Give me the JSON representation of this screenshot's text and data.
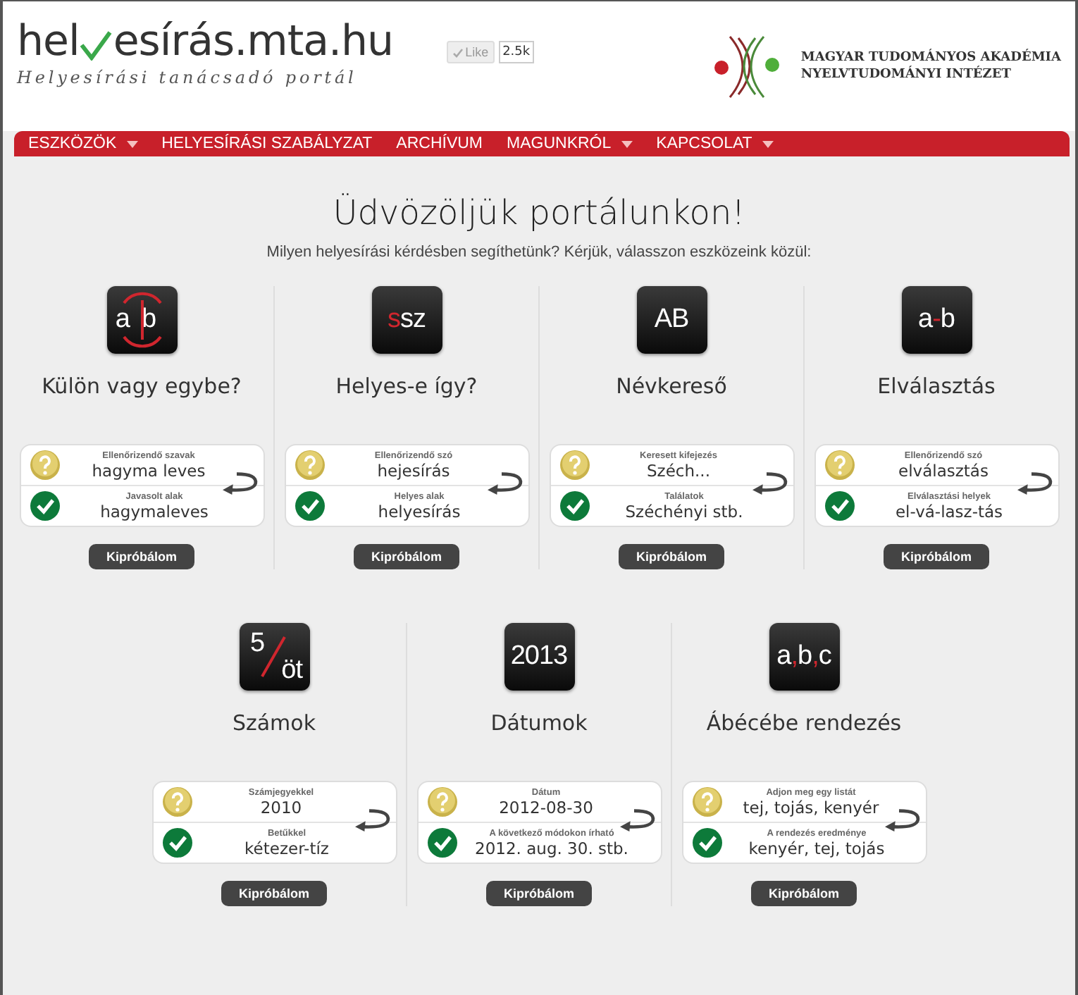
{
  "header": {
    "logo_start": "hel",
    "logo_end": "esírás.mta.hu",
    "tagline": "Helyesírási tanácsadó portál",
    "like": {
      "label": "Like",
      "count": "2.5k"
    },
    "institute": [
      "MAGYAR TUDOMÁNYOS AKADÉMIA",
      "NYELVTUDOMÁNYI INTÉZET"
    ]
  },
  "nav": [
    {
      "label": "ESZKÖZÖK",
      "dropdown": true
    },
    {
      "label": "HELYESÍRÁSI SZABÁLYZAT",
      "dropdown": false
    },
    {
      "label": "ARCHÍVUM",
      "dropdown": false
    },
    {
      "label": "MAGUNKRÓL",
      "dropdown": true
    },
    {
      "label": "KAPCSOLAT",
      "dropdown": true
    }
  ],
  "welcome": {
    "title": "Üdvözöljük portálunkon!",
    "subtitle": "Milyen helyesírási kérdésben segíthetünk? Kérjük, válasszon eszközeink közül:"
  },
  "tool_rows": [
    [
      {
        "kind": "split",
        "icon_parts": [
          {
            "text": "a",
            "accent": false
          },
          {
            "text": "b",
            "accent": false
          }
        ],
        "title": "Külön vagy egybe?",
        "question_label": "Ellenőrizendő szavak",
        "question": "hagyma leves",
        "answer_label": "Javasolt alak",
        "answer": "hagymaleves",
        "button": "Kipróbálom"
      },
      {
        "kind": "plain",
        "icon_parts": [
          {
            "text": "s",
            "accent": true
          },
          {
            "text": "sz",
            "accent": false
          }
        ],
        "title": "Helyes-e így?",
        "question_label": "Ellenőrizendő szó",
        "question": "hejesírás",
        "answer_label": "Helyes alak",
        "answer": "helyesírás",
        "button": "Kipróbálom"
      },
      {
        "kind": "plain",
        "icon_parts": [
          {
            "text": "AB",
            "accent": false
          }
        ],
        "title": "Névkereső",
        "question_label": "Keresett kifejezés",
        "question": "Széch...",
        "answer_label": "Találatok",
        "answer": "Széchényi stb.",
        "button": "Kipróbálom"
      },
      {
        "kind": "plain",
        "icon_parts": [
          {
            "text": "a",
            "accent": false
          },
          {
            "text": "-",
            "accent": true
          },
          {
            "text": "b",
            "accent": false
          }
        ],
        "title": "Elválasztás",
        "question_label": "Ellenőrizendő szó",
        "question": "elválasztás",
        "answer_label": "Elválasztási helyek",
        "answer": "el-vá-lasz-tás",
        "button": "Kipróbálom"
      }
    ],
    [
      {
        "kind": "fraction",
        "icon_parts": [
          {
            "text": "5",
            "accent": false
          },
          {
            "text": "öt",
            "accent": false
          }
        ],
        "title": "Számok",
        "question_label": "Számjegyekkel",
        "question": "2010",
        "answer_label": "Betűkkel",
        "answer": "kétezer-tíz",
        "button": "Kipróbálom"
      },
      {
        "kind": "plain",
        "icon_parts": [
          {
            "text": "2013",
            "accent": false
          }
        ],
        "title": "Dátumok",
        "question_label": "Dátum",
        "question": "2012-08-30",
        "answer_label": "A következő módokon írható",
        "answer": "2012. aug. 30. stb.",
        "button": "Kipróbálom"
      },
      {
        "kind": "plain",
        "icon_parts": [
          {
            "text": "a",
            "accent": false
          },
          {
            "text": ",",
            "accent": true
          },
          {
            "text": "b",
            "accent": false
          },
          {
            "text": ",",
            "accent": true
          },
          {
            "text": "c",
            "accent": false
          }
        ],
        "title": "Ábécébe rendezés",
        "question_label": "Adjon meg egy listát",
        "question": "tej, tojás, kenyér",
        "answer_label": "A rendezés eredménye",
        "answer": "kenyér, tej, tojás",
        "button": "Kipróbálom"
      }
    ]
  ]
}
